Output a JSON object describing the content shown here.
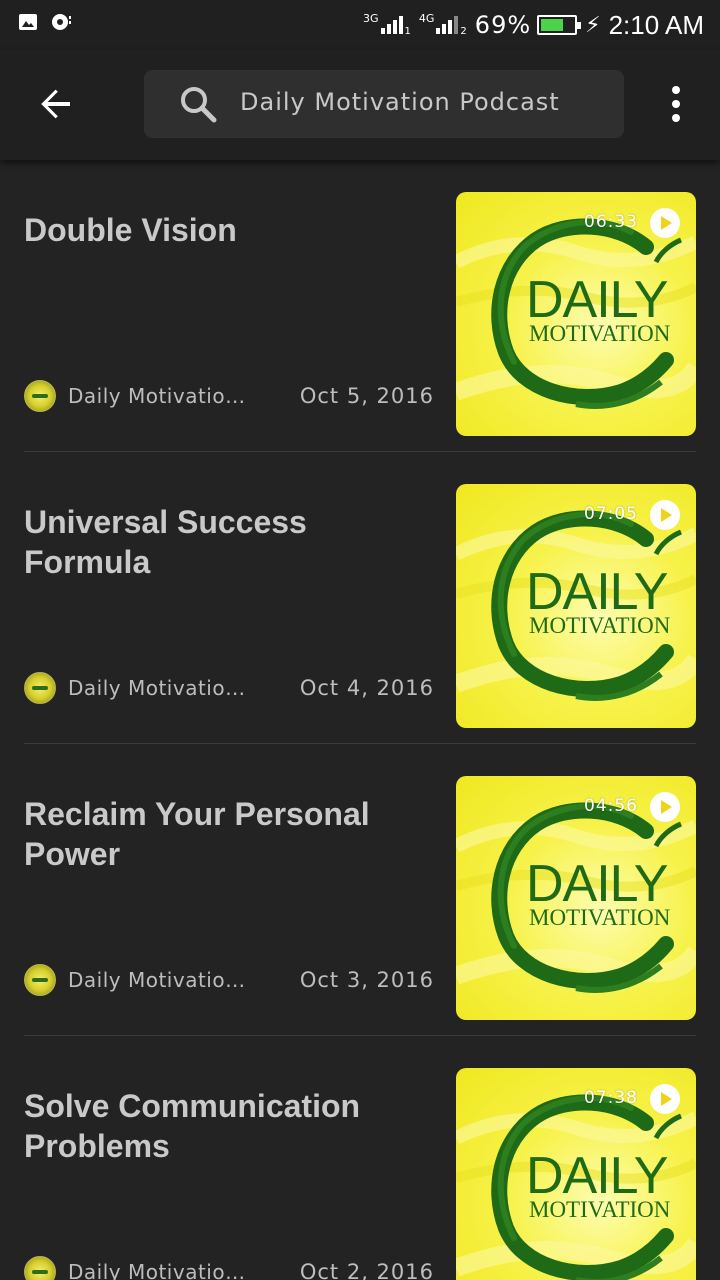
{
  "status_bar": {
    "net1": "3G",
    "sim1": "1",
    "net2": "4G",
    "sim2": "2",
    "battery_text": "69%",
    "battery_level": 0.69,
    "time": "2:10 AM"
  },
  "app_bar": {
    "search_text": "Daily Motivation Podcast",
    "icons": [
      "back-arrow-icon",
      "search-icon",
      "more-vert-icon"
    ]
  },
  "episodes": [
    {
      "title": "Double Vision",
      "podcast": "Daily Motivatio…",
      "date": "Oct 5, 2016",
      "duration": "06:33",
      "logo_line1": "DAILY",
      "logo_line2": "MOTIVATION"
    },
    {
      "title": "Universal Success Formula",
      "podcast": "Daily Motivatio…",
      "date": "Oct 4, 2016",
      "duration": "07:05",
      "logo_line1": "DAILY",
      "logo_line2": "MOTIVATION"
    },
    {
      "title": "Reclaim Your Personal Power",
      "podcast": "Daily Motivatio…",
      "date": "Oct 3, 2016",
      "duration": "04:56",
      "logo_line1": "DAILY",
      "logo_line2": "MOTIVATION"
    },
    {
      "title": "Solve Communication Problems",
      "podcast": "Daily Motivatio…",
      "date": "Oct 2, 2016",
      "duration": "07:38",
      "logo_line1": "DAILY",
      "logo_line2": "MOTIVATION"
    }
  ],
  "colors": {
    "background": "#232323",
    "app_bar": "#202020",
    "search_box": "#2f2f2f",
    "title_text": "#c9c9c9",
    "meta_text": "#bdbdbd",
    "thumb_yellow": "#f7f24a",
    "logo_green": "#1f6a16",
    "battery_fill": "#4cd34c"
  }
}
